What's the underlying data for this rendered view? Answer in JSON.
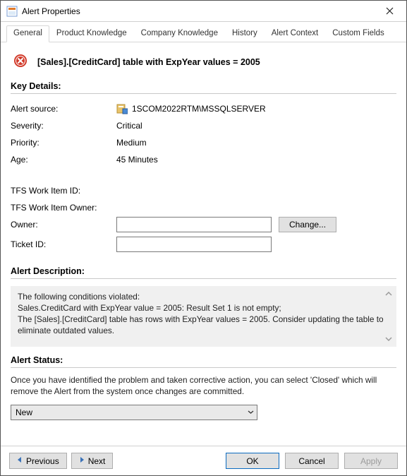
{
  "window": {
    "title": "Alert Properties"
  },
  "tabs": {
    "items": [
      "General",
      "Product Knowledge",
      "Company Knowledge",
      "History",
      "Alert Context",
      "Custom Fields"
    ],
    "active": 0
  },
  "alert": {
    "title": "[Sales].[CreditCard] table with ExpYear values = 2005"
  },
  "sections": {
    "key_details": "Key Details:",
    "alert_description": "Alert Description:",
    "alert_status": "Alert Status:"
  },
  "details": {
    "labels": {
      "alert_source": "Alert source:",
      "severity": "Severity:",
      "priority": "Priority:",
      "age": "Age:",
      "tfs_id": "TFS Work Item ID:",
      "tfs_owner": "TFS Work Item Owner:",
      "owner": "Owner:",
      "ticket_id": "Ticket ID:"
    },
    "values": {
      "alert_source": "1SCOM2022RTM\\MSSQLSERVER",
      "severity": "Critical",
      "priority": "Medium",
      "age": "45 Minutes",
      "tfs_id": "",
      "tfs_owner": "",
      "owner": "",
      "ticket_id": ""
    },
    "change_label": "Change..."
  },
  "description": {
    "line1": "The following conditions violated:",
    "line2": "Sales.CreditCard with ExpYear value = 2005: Result Set 1 is not empty;",
    "line3": "The [Sales].[CreditCard] table has rows with ExpYear values = 2005. Consider updating the table to eliminate outdated values."
  },
  "status": {
    "help": "Once you have identified the problem and taken corrective action, you can select 'Closed' which will remove the Alert from the system once changes are committed.",
    "selected": "New"
  },
  "footer": {
    "previous": "Previous",
    "next": "Next",
    "ok": "OK",
    "cancel": "Cancel",
    "apply": "Apply"
  }
}
